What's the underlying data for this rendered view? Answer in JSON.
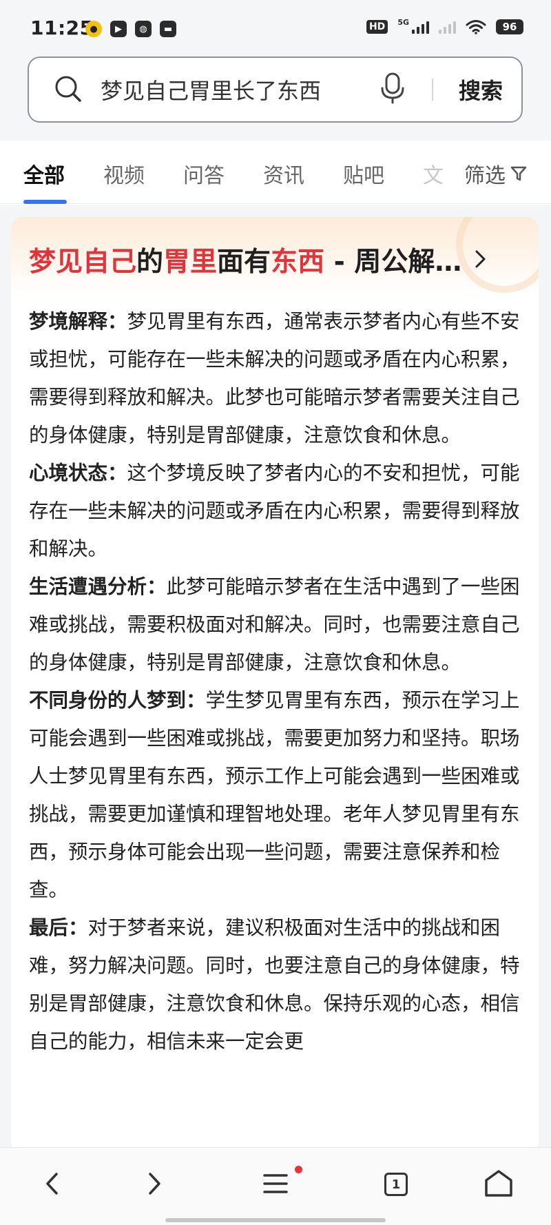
{
  "status_bar": {
    "time": "11:25",
    "hd_label": "HD",
    "signal_label": "5G",
    "battery": "96"
  },
  "search": {
    "query": "梦见自己胃里长了东西",
    "button_label": "搜索"
  },
  "tabs": [
    {
      "label": "全部",
      "active": true
    },
    {
      "label": "视频"
    },
    {
      "label": "问答"
    },
    {
      "label": "资讯"
    },
    {
      "label": "贴吧"
    },
    {
      "label": "文"
    }
  ],
  "filter_label": "筛选",
  "result": {
    "title_parts": {
      "p1": "梦见自己",
      "p2": "的",
      "p3": "胃里",
      "p4": "面有",
      "p5": "东西",
      "p6": " - 周公解…"
    },
    "paragraphs": [
      {
        "title": "梦境解释：",
        "text": "梦见胃里有东西，通常表示梦者内心有些不安或担忧，可能存在一些未解决的问题或矛盾在内心积累，需要得到释放和解决。此梦也可能暗示梦者需要关注自己的身体健康，特别是胃部健康，注意饮食和休息。"
      },
      {
        "title": "心境状态：",
        "text": "这个梦境反映了梦者内心的不安和担忧，可能存在一些未解决的问题或矛盾在内心积累，需要得到释放和解决。"
      },
      {
        "title": "生活遭遇分析：",
        "text": "此梦可能暗示梦者在生活中遇到了一些困难或挑战，需要积极面对和解决。同时，也需要注意自己的身体健康，特别是胃部健康，注意饮食和休息。"
      },
      {
        "title": "不同身份的人梦到：",
        "text": "学生梦见胃里有东西，预示在学习上可能会遇到一些困难或挑战，需要更加努力和坚持。职场人士梦见胃里有东西，预示工作上可能会遇到一些困难或挑战，需要更加谨慎和理智地处理。老年人梦见胃里有东西，预示身体可能会出现一些问题，需要注意保养和检查。"
      },
      {
        "title": "最后：",
        "text": "对于梦者来说，建议积极面对生活中的挑战和困难，努力解决问题。同时，也要注意自己的身体健康，特别是胃部健康，注意饮食和休息。保持乐观的心态，相信自己的能力，相信未来一定会更"
      }
    ]
  },
  "bottom_nav": {
    "tab_count": "1"
  },
  "colors": {
    "highlight": "#e0333a",
    "tab_indicator": "#3a72f5",
    "notify_dot": "#e8333a"
  }
}
